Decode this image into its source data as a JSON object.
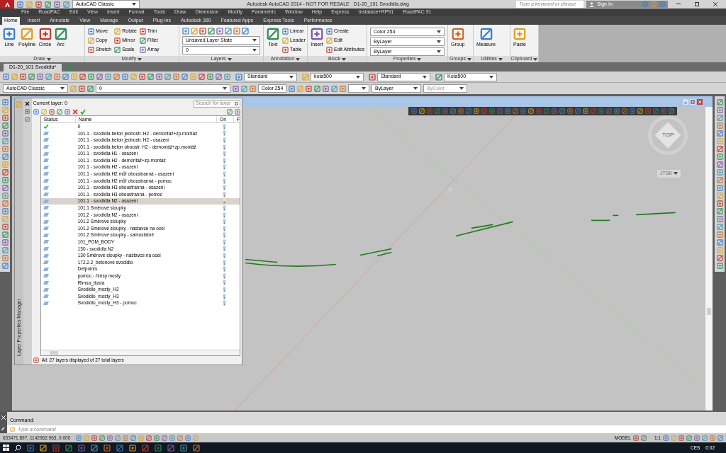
{
  "title_bar": {
    "workspace": "AutoCAD Classic",
    "title": "Autodesk AutoCAD 2014 - NOT FOR RESALE   D1-20_101 Svodidla.dwg",
    "search_placeholder": "Type a keyword or phrase",
    "sign_in": "Sign In"
  },
  "menu": [
    "File",
    "RoadPAC",
    "Edit",
    "View",
    "Insert",
    "Format",
    "Tools",
    "Draw",
    "Dimension",
    "Modify",
    "Parametric",
    "Window",
    "Help",
    "Express",
    "Instalace+RP91",
    "RoadPAC 91"
  ],
  "ribbon_tabs": [
    {
      "label": "Home",
      "selected": true
    },
    {
      "label": "Insert",
      "selected": false
    },
    {
      "label": "Annotate",
      "selected": false
    },
    {
      "label": "View",
      "selected": false
    },
    {
      "label": "Manage",
      "selected": false
    },
    {
      "label": "Output",
      "selected": false
    },
    {
      "label": "Plug-ins",
      "selected": false
    },
    {
      "label": "Autodesk 360",
      "selected": false
    },
    {
      "label": "Featured Apps",
      "selected": false
    },
    {
      "label": "Express Tools",
      "selected": false
    },
    {
      "label": "Performance",
      "selected": false
    }
  ],
  "ribbon_panels": [
    {
      "title": "Draw",
      "large": [
        "Line",
        "Polyline",
        "Circle",
        "Arc"
      ]
    },
    {
      "title": "Modify",
      "small": [
        "Move",
        "Copy",
        "Stretch",
        "Rotate",
        "Mirror",
        "Scale",
        "Trim",
        "Fillet",
        "Array"
      ]
    },
    {
      "title": "Layers",
      "dropdowns": [
        "Unsaved Layer State",
        "0"
      ]
    },
    {
      "title": "Annotation",
      "large": [
        "Text"
      ],
      "small": [
        "Linear",
        "Leader",
        "Table"
      ]
    },
    {
      "title": "Block",
      "large": [
        "Insert"
      ],
      "small": [
        "Create",
        "Edit",
        "Edit Attributes"
      ]
    },
    {
      "title": "Properties",
      "dropdowns": [
        "Color 254",
        "ByLayer",
        "ByLayer"
      ]
    },
    {
      "title": "Groups",
      "large": [
        "Group"
      ]
    },
    {
      "title": "Utilities",
      "large": [
        "Measure"
      ]
    },
    {
      "title": "Clipboard",
      "large": [
        "Paste"
      ]
    }
  ],
  "file_tabs": [
    {
      "label": "D1-20_101 Svodidla*",
      "selected": true
    }
  ],
  "toolbar_row_1": [
    "Standard",
    "kota500",
    "Standard",
    "Kota500"
  ],
  "toolbar_row_2": {
    "workspace": "AutoCAD Classic",
    "layer": "0",
    "color_label": "Color 254",
    "linetype": "ByLayer",
    "lineweight": "ByColor"
  },
  "layer_manager": {
    "title": "Layer Properties Manager",
    "current_layer": "Current layer: 0",
    "search_placeholder": "Search for layer",
    "columns": [
      "Status",
      "Name",
      "On",
      "F"
    ],
    "footer": "All: 27 layers displayed of 27 total layers",
    "rows": [
      {
        "kind": "current",
        "name": "0",
        "selected": false
      },
      {
        "kind": "layer",
        "name": "101.1 - svodidla beton jednostr. H2 - demontáž+zp.montáž",
        "selected": false
      },
      {
        "kind": "layer",
        "name": "101.1 - svodidla beton jednostr. H2 - osazení",
        "selected": false
      },
      {
        "kind": "layer",
        "name": "101.1 - svodidla beton oboustr. H2 - demontáž+zp.montáž",
        "selected": false
      },
      {
        "kind": "layer",
        "name": "101.1 - svodidla H1 - osazení",
        "selected": false
      },
      {
        "kind": "layer",
        "name": "101.1 - svodidla H2 - demontáž+zp.montáž",
        "selected": false
      },
      {
        "kind": "layer",
        "name": "101.1 - svodidla H2 - osazení",
        "selected": false
      },
      {
        "kind": "layer",
        "name": "101.1 - svodidla H2 můř oboustranná - osazení",
        "selected": false
      },
      {
        "kind": "layer",
        "name": "101.1 - svodidla H2 můř oboustranná - pomoc",
        "selected": false
      },
      {
        "kind": "layer",
        "name": "101.1 - svodidla H3 oboustranná - osazení",
        "selected": false
      },
      {
        "kind": "layer",
        "name": "101.1 - svodidla H3 oboustranná - pomoc",
        "selected": false
      },
      {
        "kind": "layer",
        "name": "101.1 - svodidla N2 - osazení",
        "selected": true
      },
      {
        "kind": "layer",
        "name": "101.1 Směrové sloupky",
        "selected": false
      },
      {
        "kind": "layer",
        "name": "101.2 - svodidla N2 - osazení",
        "selected": false
      },
      {
        "kind": "layer",
        "name": "101.2 Směrové sloupky",
        "selected": false
      },
      {
        "kind": "layer",
        "name": "101.2 Směrové sloupky - nástavce na ocel",
        "selected": false
      },
      {
        "kind": "layer",
        "name": "101.2 Směrové sloupky - samostatné",
        "selected": false
      },
      {
        "kind": "layer",
        "name": "101_POM_BODY",
        "selected": false
      },
      {
        "kind": "layer",
        "name": "130 - svodidla N2",
        "selected": false
      },
      {
        "kind": "layer",
        "name": "130 Směrové sloupky - nástavce na ocel",
        "selected": false
      },
      {
        "kind": "layer",
        "name": "172.2.2_betonové svodidlo",
        "selected": false
      },
      {
        "kind": "layer",
        "name": "Defpoints",
        "selected": false
      },
      {
        "kind": "layer",
        "name": "pomoc - římsy mosty",
        "selected": false
      },
      {
        "kind": "layer",
        "name": "Rimsa_tlusta",
        "selected": false
      },
      {
        "kind": "layer",
        "name": "Svodidlo_mosty_H2",
        "selected": false
      },
      {
        "kind": "layer",
        "name": "Svodidlo_mosty_H3",
        "selected": false
      },
      {
        "kind": "layer",
        "name": "Svodidlo_mosty_H3 - pomoc",
        "selected": false
      }
    ]
  },
  "view_cube": {
    "face": "TOP",
    "ucs": "JTSK"
  },
  "command_line": {
    "history": "Command:",
    "placeholder": "Type a command"
  },
  "status_bar": {
    "coordinates": "633471.897, 1142962.963, 0.000",
    "space": "MODEL",
    "scale": "1:1"
  },
  "taskbar": {
    "language": "CES",
    "time": "0:02"
  }
}
